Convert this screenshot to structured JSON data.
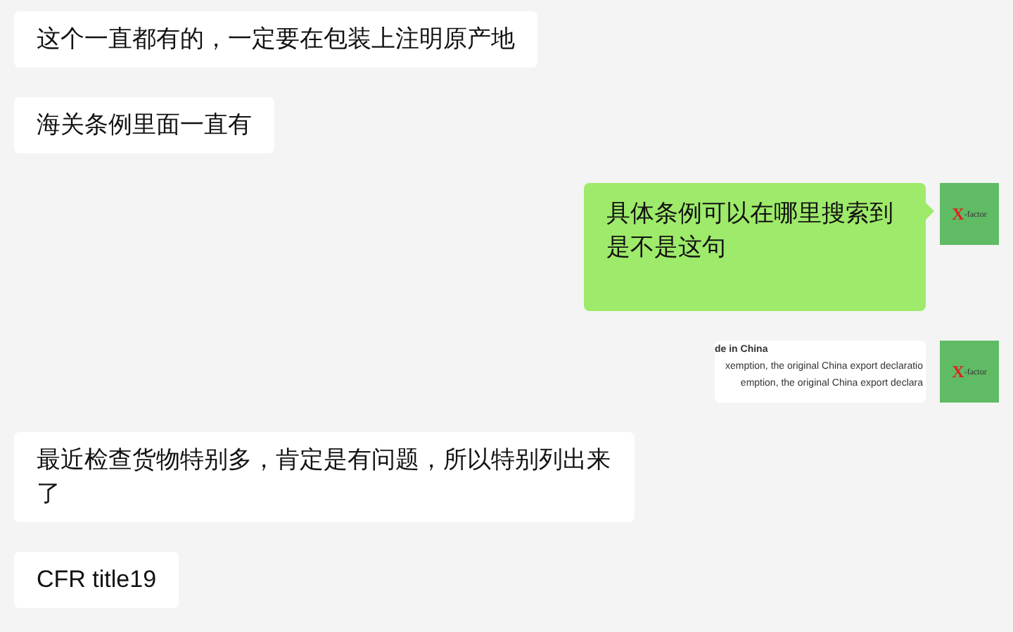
{
  "messages": [
    {
      "outgoing": false,
      "kind": "text",
      "text": "这个一直都有的，一定要在包装上注明原产地"
    },
    {
      "outgoing": false,
      "kind": "text",
      "text": "海关条例里面一直有"
    },
    {
      "outgoing": true,
      "kind": "text",
      "text": "具体条例可以在哪里搜索到是不是这句",
      "avatar": {
        "mark": "X",
        "suffix": "-factor"
      }
    },
    {
      "outgoing": true,
      "kind": "image",
      "lines": [
        {
          "text": "de in China",
          "bold": true
        },
        {
          "text": "xemption, the original China export declaratio",
          "bold": false
        },
        {
          "text": "emption, the original China export declara",
          "bold": false
        }
      ],
      "avatar": {
        "mark": "X",
        "suffix": "-factor"
      }
    },
    {
      "outgoing": false,
      "kind": "text",
      "text": "最近检查货物特别多，肯定是有问题，所以特别列出来了"
    },
    {
      "outgoing": false,
      "kind": "text",
      "text": "CFR title19"
    }
  ]
}
